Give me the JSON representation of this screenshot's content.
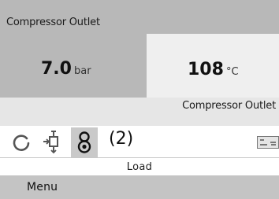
{
  "panel_left": {
    "title": "Compressor Outlet",
    "value": "7.0",
    "unit": "bar"
  },
  "panel_right": {
    "value": "108",
    "unit": "°C",
    "title": "Compressor Outlet"
  },
  "status_icons": [
    "refresh-icon",
    "fan-icon",
    "load-icon",
    "card-icon"
  ],
  "status": {
    "count": "(2)",
    "state": "Load"
  },
  "menu": {
    "label": "Menu"
  },
  "colors": {
    "panel_dark": "#b8b8b8",
    "panel_light": "#efefef",
    "band": "#e6e6e6",
    "menu_bar": "#c4c4c4"
  }
}
